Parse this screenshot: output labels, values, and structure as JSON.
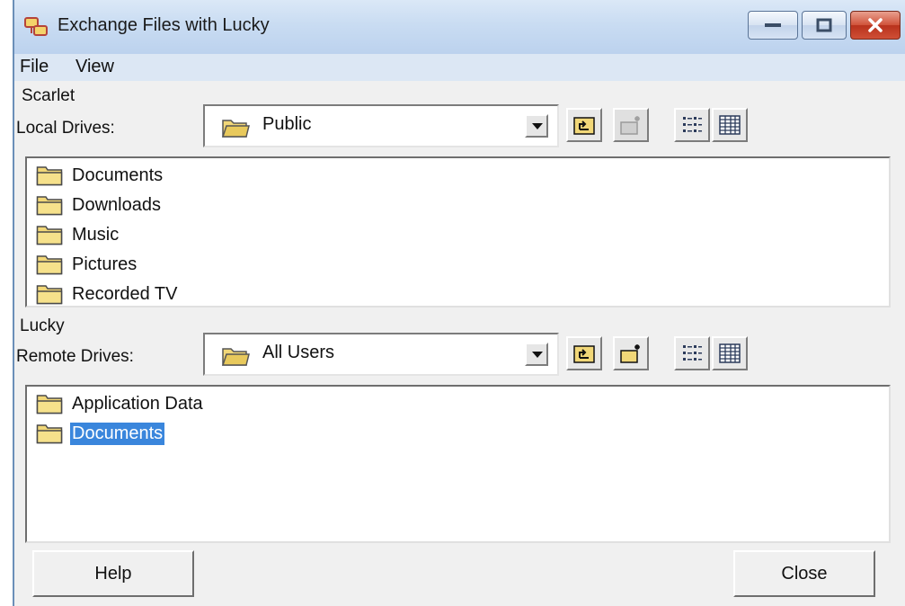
{
  "window": {
    "title": "Exchange Files with Lucky"
  },
  "menu": {
    "file": "File",
    "view": "View"
  },
  "local": {
    "computer_name": "Scarlet",
    "drives_label": "Local Drives:",
    "selected_drive": "Public",
    "items": [
      {
        "name": "Documents"
      },
      {
        "name": "Downloads"
      },
      {
        "name": "Music"
      },
      {
        "name": "Pictures"
      },
      {
        "name": "Recorded TV"
      }
    ]
  },
  "remote": {
    "computer_name": "Lucky",
    "drives_label": "Remote Drives:",
    "selected_drive": "All Users",
    "items": [
      {
        "name": "Application Data",
        "selected": false
      },
      {
        "name": "Documents",
        "selected": true
      }
    ]
  },
  "buttons": {
    "help": "Help",
    "close": "Close"
  },
  "icons": {
    "app": "two-computers-icon",
    "folder": "folder-icon",
    "up": "up-folder-icon",
    "new_folder": "new-folder-icon",
    "list_view": "list-view-icon",
    "details_view": "details-view-icon"
  },
  "colors": {
    "selection": "#3a86dc",
    "titlebar": "#c9dcf2",
    "close_button": "#c8452d"
  }
}
